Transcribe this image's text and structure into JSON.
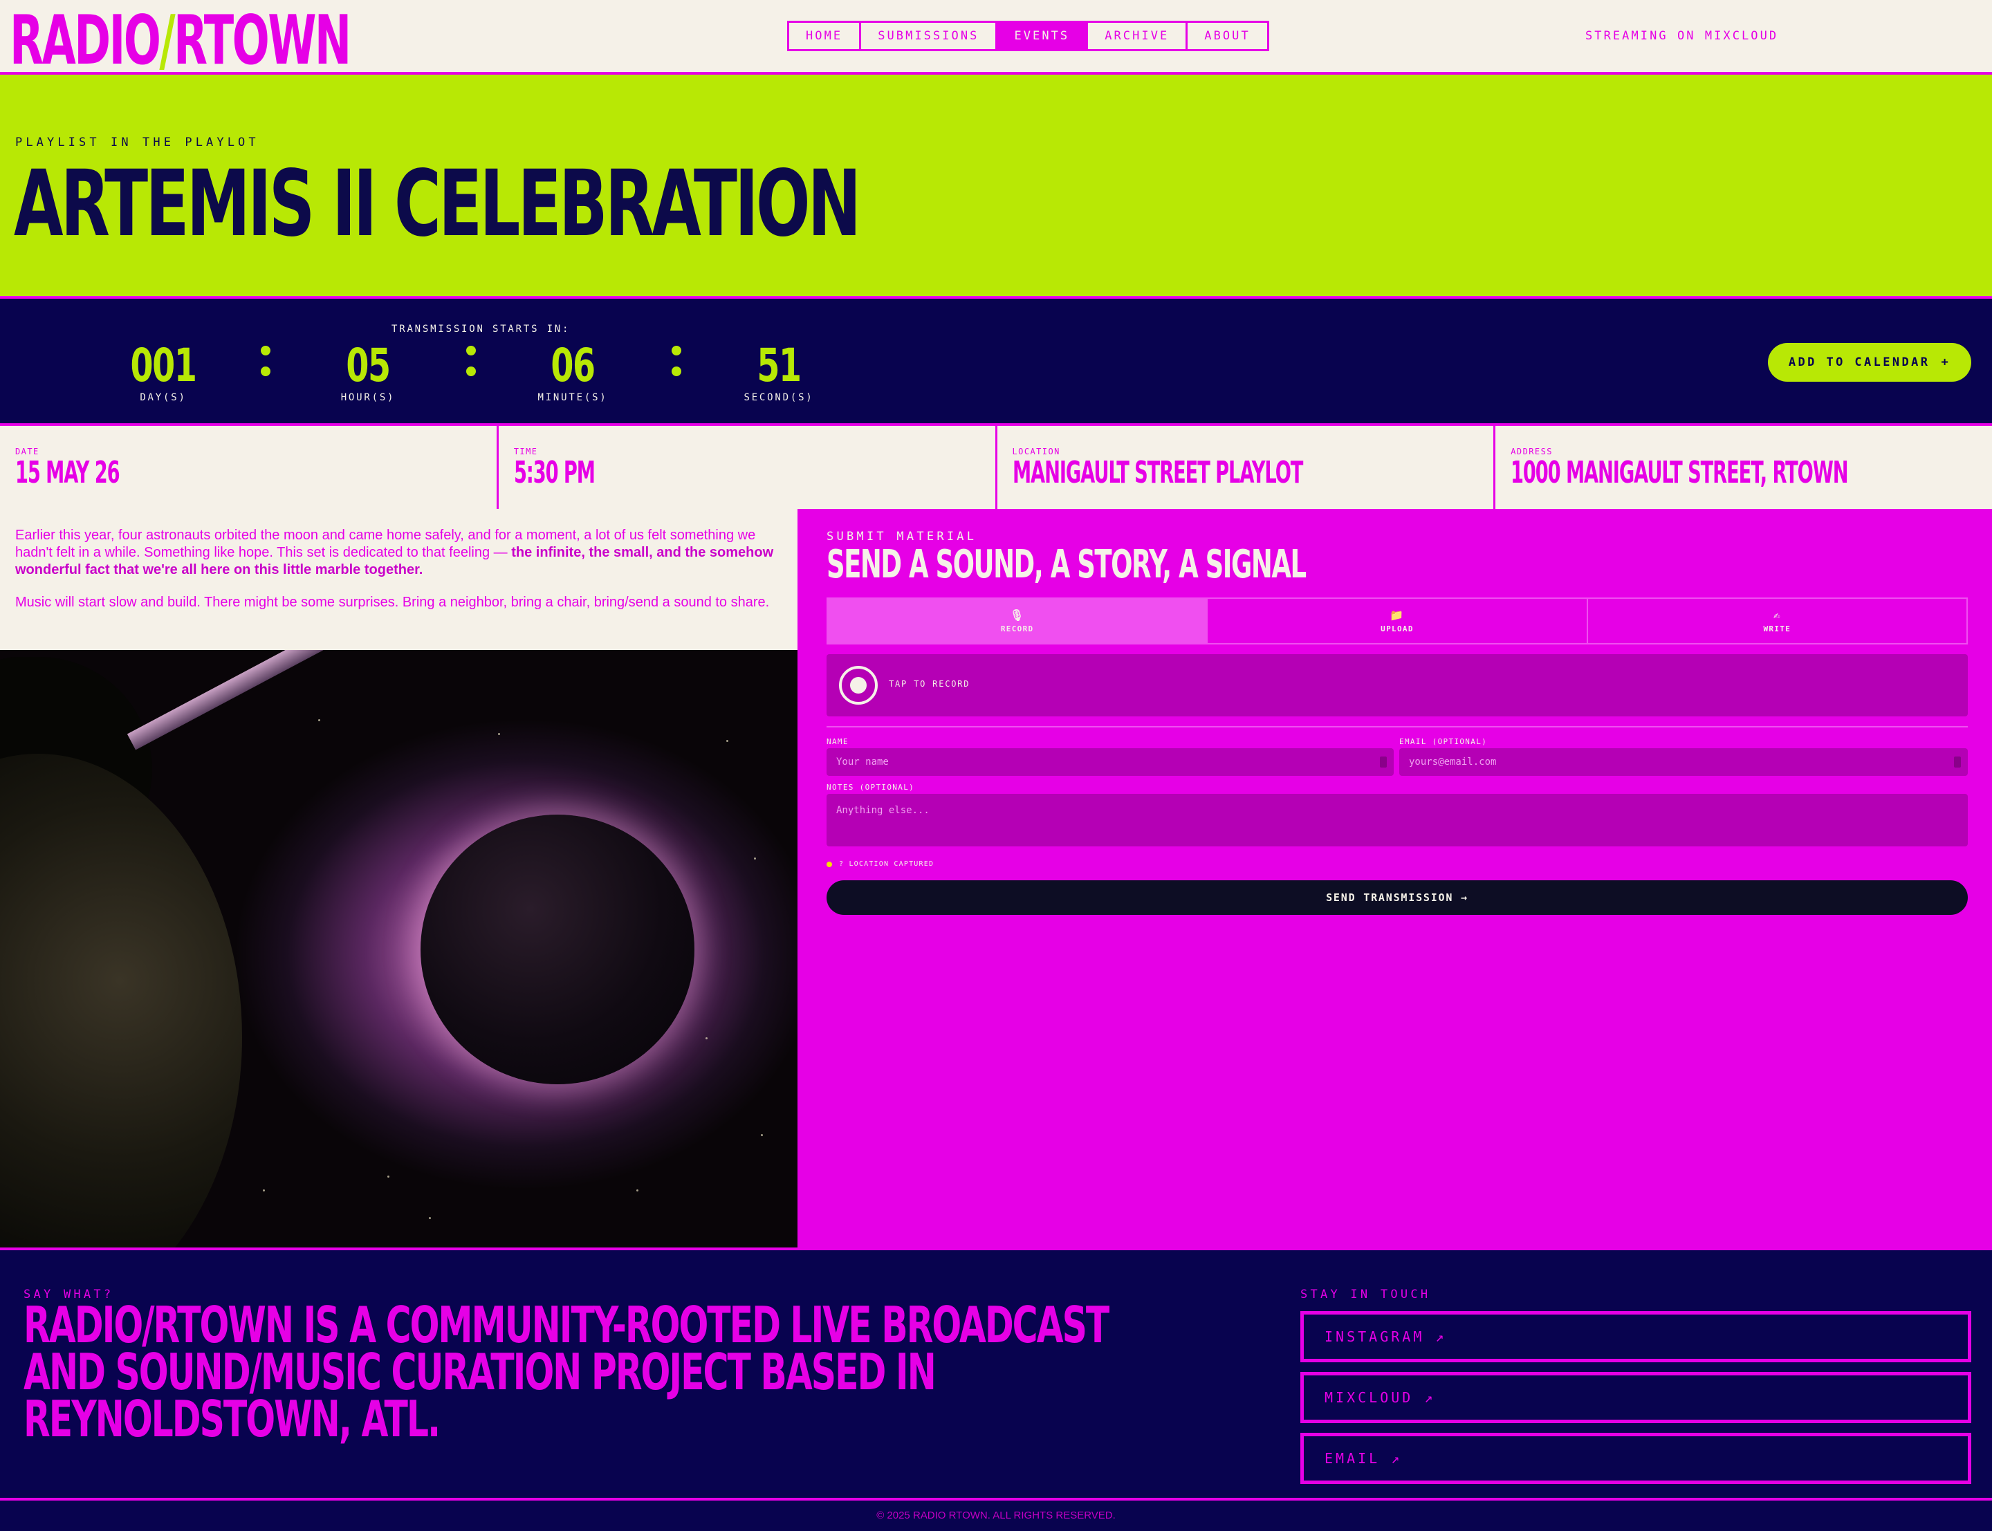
{
  "header": {
    "logo": {
      "left": "RADIO",
      "slash": "/",
      "right": "RTOWN"
    },
    "nav": [
      {
        "label": "HOME",
        "active": false
      },
      {
        "label": "SUBMISSIONS",
        "active": false
      },
      {
        "label": "EVENTS",
        "active": true
      },
      {
        "label": "ARCHIVE",
        "active": false
      },
      {
        "label": "ABOUT",
        "active": false
      }
    ],
    "streaming": "STREAMING ON MIXCLOUD"
  },
  "hero": {
    "kicker": "PLAYLIST IN THE PLAYLOT",
    "title": "ARTEMIS II CELEBRATION"
  },
  "countdown": {
    "label": "TRANSMISSION STARTS IN:",
    "units": [
      {
        "value": "001",
        "caption": "DAY(S)"
      },
      {
        "value": "05",
        "caption": "HOUR(S)"
      },
      {
        "value": "06",
        "caption": "MINUTE(S)"
      },
      {
        "value": "51",
        "caption": "SECOND(S)"
      }
    ],
    "calendar_button": "ADD TO CALENDAR",
    "calendar_icon": "+"
  },
  "info": [
    {
      "caption": "DATE",
      "value": "15 MAY 26"
    },
    {
      "caption": "TIME",
      "value": "5:30 PM"
    },
    {
      "caption": "LOCATION",
      "value": "MANIGAULT STREET PLAYLOT"
    },
    {
      "caption": "ADDRESS",
      "value": "1000 MANIGAULT STREET, RTOWN"
    }
  ],
  "description": {
    "p1_plain": "Earlier this year, four astronauts orbited the moon and came home safely, and for a moment, a lot of us felt something we hadn't felt in a while. Something like hope. This set is dedicated to that feeling — ",
    "p1_bold": "the infinite, the small, and the somehow wonderful fact that we're all here on this little marble together.",
    "p2": "Music will start slow and build. There might be some surprises. Bring a neighbor, bring a chair, bring/send a sound to share."
  },
  "submit": {
    "kicker": "SUBMIT MATERIAL",
    "title": "SEND A SOUND, A STORY, A SIGNAL",
    "tabs": [
      {
        "icon": "🎙",
        "label": "RECORD",
        "active": true
      },
      {
        "icon": "📁",
        "label": "UPLOAD",
        "active": false
      },
      {
        "icon": "✍",
        "label": "WRITE",
        "active": false
      }
    ],
    "record_label": "TAP TO RECORD",
    "name_label": "NAME",
    "name_placeholder": "Your name",
    "email_label": "EMAIL (OPTIONAL)",
    "email_placeholder": "yours@email.com",
    "notes_label": "NOTES (OPTIONAL)",
    "notes_placeholder": "Anything else...",
    "location_status": "? LOCATION CAPTURED",
    "send_button": "SEND TRANSMISSION →"
  },
  "footer": {
    "say_label": "SAY WHAT?",
    "blurb": "RADIO/RTOWN IS A COMMUNITY-ROOTED LIVE BROADCAST AND SOUND/MUSIC CURATION PROJECT BASED IN REYNOLDSTOWN, ATL.",
    "stay_label": "STAY IN TOUCH",
    "links": [
      {
        "label": "INSTAGRAM ↗"
      },
      {
        "label": "MIXCLOUD ↗"
      },
      {
        "label": "EMAIL ↗"
      }
    ],
    "copyright": "© 2025 RADIO RTOWN. ALL RIGHTS RESERVED."
  },
  "colors": {
    "magenta": "#e600e6",
    "lime": "#b8e805",
    "navy": "#08034f",
    "cream": "#f5f1e8"
  }
}
